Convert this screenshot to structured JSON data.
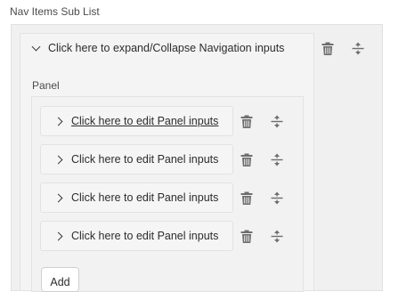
{
  "list_title": "Nav Items Sub List",
  "nav_item": {
    "header_label": "Click here to expand/Collapse Navigation inputs",
    "panel_label": "Panel"
  },
  "panels": [
    {
      "label": "Click here to edit Panel inputs",
      "hovered": true
    },
    {
      "label": "Click here to edit Panel inputs",
      "hovered": false
    },
    {
      "label": "Click here to edit Panel inputs",
      "hovered": false
    },
    {
      "label": "Click here to edit Panel inputs",
      "hovered": false
    }
  ],
  "add_button_label": "Add",
  "icons": {
    "delete": "trash-icon",
    "reorder": "drag-handle-icon",
    "expanded": "chevron-down-icon",
    "collapsed": "chevron-right-icon"
  },
  "colors": {
    "icon": "#6e6e6e",
    "background": "#f0f0f0"
  }
}
